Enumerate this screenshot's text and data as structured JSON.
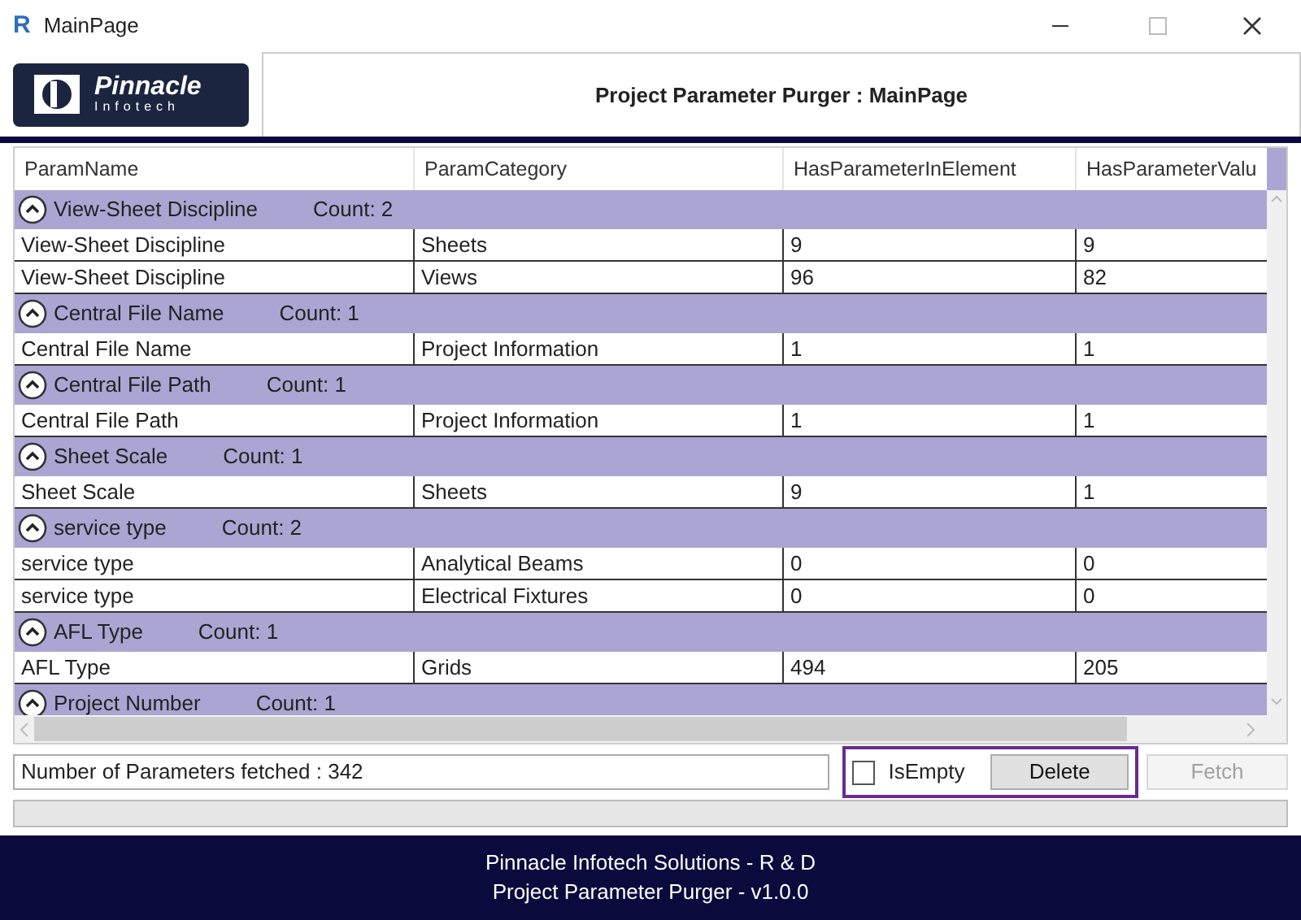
{
  "window": {
    "title": "MainPage",
    "app_icon": "R"
  },
  "logo": {
    "name": "Pinnacle",
    "subtitle": "Infotech"
  },
  "header": {
    "title": "Project Parameter Purger : MainPage"
  },
  "table": {
    "columns": [
      "ParamName",
      "ParamCategory",
      "HasParameterInElement",
      "HasParameterValu"
    ],
    "groups": [
      {
        "name": "View-Sheet Discipline",
        "count": "Count: 2",
        "expanded": true,
        "rows": [
          [
            "View-Sheet Discipline",
            "Sheets",
            "9",
            "9"
          ],
          [
            "View-Sheet Discipline",
            "Views",
            "96",
            "82"
          ]
        ]
      },
      {
        "name": "Central File Name",
        "count": "Count: 1",
        "expanded": true,
        "rows": [
          [
            "Central File Name",
            "Project Information",
            "1",
            "1"
          ]
        ]
      },
      {
        "name": "Central File Path",
        "count": "Count: 1",
        "expanded": true,
        "rows": [
          [
            "Central File Path",
            "Project Information",
            "1",
            "1"
          ]
        ]
      },
      {
        "name": "Sheet Scale",
        "count": "Count: 1",
        "expanded": true,
        "rows": [
          [
            "Sheet Scale",
            "Sheets",
            "9",
            "1"
          ]
        ]
      },
      {
        "name": "service type",
        "count": "Count: 2",
        "expanded": true,
        "rows": [
          [
            "service type",
            "Analytical Beams",
            "0",
            "0"
          ],
          [
            "service type",
            "Electrical Fixtures",
            "0",
            "0"
          ]
        ]
      },
      {
        "name": "AFL Type",
        "count": "Count: 1",
        "expanded": true,
        "rows": [
          [
            "AFL Type",
            "Grids",
            "494",
            "205"
          ]
        ]
      },
      {
        "name": "Project Number",
        "count": "Count: 1",
        "expanded": true
      }
    ]
  },
  "status": {
    "value": "Number of Parameters fetched : 342"
  },
  "is_empty": {
    "label": "IsEmpty",
    "checked": false
  },
  "buttons": [
    {
      "label": "Delete",
      "disabled": false
    },
    {
      "label": "Fetch",
      "disabled": true
    }
  ],
  "footer": [
    "Pinnacle Infotech Solutions - R & D",
    "Project Parameter Purger - v1.0.0"
  ]
}
